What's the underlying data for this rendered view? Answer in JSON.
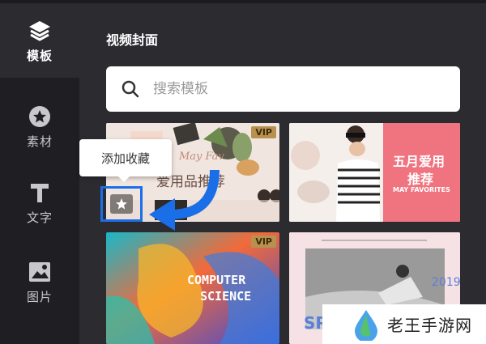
{
  "sidebar": {
    "items": [
      {
        "label": "模板",
        "icon": "layers-icon",
        "active": true
      },
      {
        "label": "素材",
        "icon": "star-circle-icon",
        "active": false
      },
      {
        "label": "文字",
        "icon": "text-t-icon",
        "active": false
      },
      {
        "label": "图片",
        "icon": "image-icon",
        "active": false
      }
    ]
  },
  "main": {
    "section_title": "视频封面",
    "search": {
      "placeholder": "搜索模板",
      "value": ""
    },
    "cards": [
      {
        "vip": "VIP",
        "script_text": "May Fav",
        "title": "爱用品推荐"
      },
      {
        "title_line1": "五月爱用",
        "title_line2": "推荐",
        "subtitle": "MAY FAVORITES"
      },
      {
        "vip": "VIP",
        "line1": "COMPUTER",
        "line2": "SCIENCE"
      },
      {
        "year": "2019",
        "partial": "SPR"
      }
    ]
  },
  "tooltip": {
    "text": "添加收藏"
  },
  "watermark": {
    "text": "老王手游网"
  },
  "colors": {
    "accent": "#1a6fe8",
    "sidebar": "#1f1f23",
    "panel": "#2b2b30",
    "vip": "#b8914f"
  }
}
